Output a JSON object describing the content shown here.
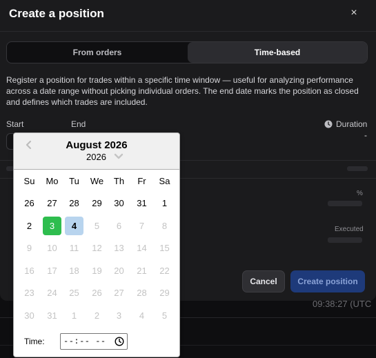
{
  "modal": {
    "title": "Create a position",
    "close_glyph": "×",
    "tabs": [
      {
        "label": "From orders",
        "active": false
      },
      {
        "label": "Time-based",
        "active": true
      }
    ],
    "description": "Register a position for trades within a specific time window — useful for analyzing performance across a date range without picking individual orders. The end date marks the position as closed and defines which trades are included.",
    "start_label": "Start",
    "end_label": "End",
    "duration_label": "Duration",
    "duration_value": "-",
    "percent_label": "%",
    "executed_label": "Executed",
    "cancel_label": "Cancel",
    "create_label": "Create position"
  },
  "background": {
    "timestamp": "09:38:27 (UTC"
  },
  "date_picker": {
    "month_label": "August 2026",
    "year_label": "2026",
    "weekdays": [
      "Su",
      "Mo",
      "Tu",
      "We",
      "Th",
      "Fr",
      "Sa"
    ],
    "weeks": [
      [
        "26",
        "27",
        "28",
        "29",
        "30",
        "31",
        "1"
      ],
      [
        "2",
        "3",
        "4",
        "5",
        "6",
        "7",
        "8"
      ],
      [
        "9",
        "10",
        "11",
        "12",
        "13",
        "14",
        "15"
      ],
      [
        "16",
        "17",
        "18",
        "19",
        "20",
        "21",
        "22"
      ],
      [
        "23",
        "24",
        "25",
        "26",
        "27",
        "28",
        "29"
      ],
      [
        "30",
        "31",
        "1",
        "2",
        "3",
        "4",
        "5"
      ]
    ],
    "today_day": "3",
    "selected_day": "4",
    "enabled_days": [
      "26",
      "27",
      "28",
      "29",
      "30",
      "31",
      "1",
      "2",
      "3",
      "4"
    ],
    "time_label": "Time:",
    "time_placeholder": "--:-- --"
  },
  "colors": {
    "today": "#2ebd4e",
    "selected": "#b8d4ee",
    "primary_button": "#1e3a7a"
  },
  "icons": [
    "close-icon",
    "clock-icon",
    "chevron-left-icon",
    "chevron-down-icon",
    "time-clock-icon"
  ]
}
